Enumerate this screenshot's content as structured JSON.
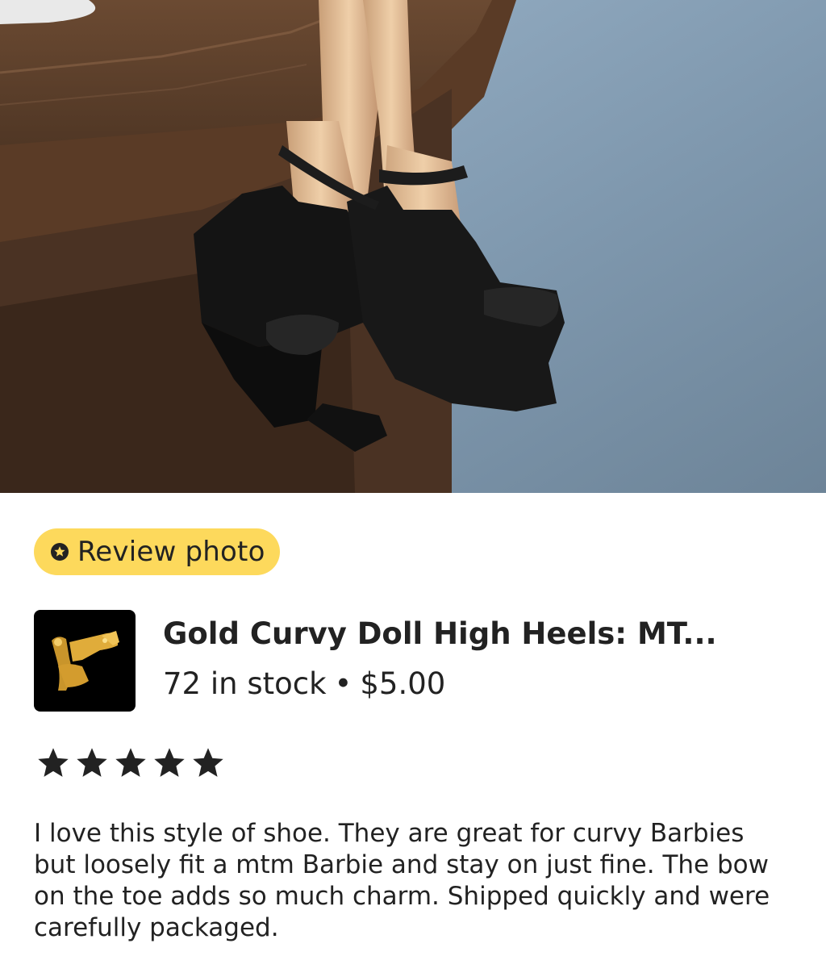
{
  "badge": {
    "label": "Review photo",
    "icon": "star-badge-icon",
    "color": "#fdd95c"
  },
  "listing": {
    "title": "Gold Curvy Doll High Heels: MT...",
    "stock": "72 in stock",
    "separator": "•",
    "price": "$5.00"
  },
  "review": {
    "rating": 5,
    "max_rating": 5,
    "text": "I love this style of shoe. They are great for curvy Barbies but loosely fit a mtm Barbie and stay on just fine. The bow on the toe adds so much charm. Shipped quickly and were carefully packaged."
  }
}
